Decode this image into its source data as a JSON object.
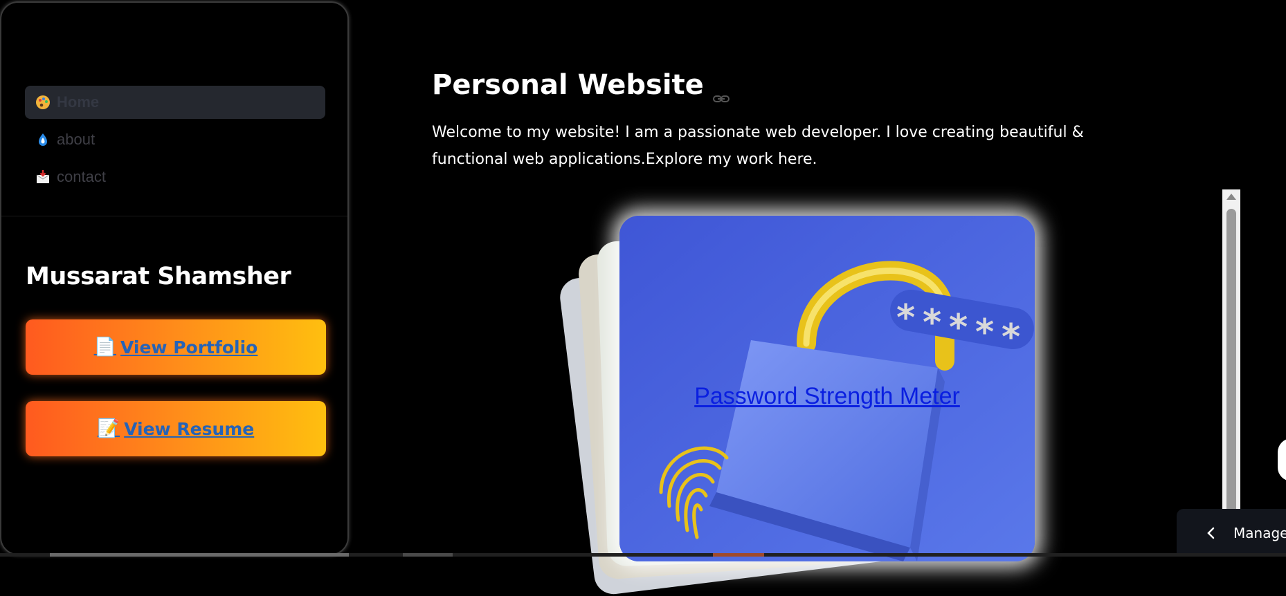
{
  "sidebar": {
    "nav": [
      {
        "label": "Home",
        "icon": "palette-icon"
      },
      {
        "label": "about",
        "icon": "drop-icon"
      },
      {
        "label": "contact",
        "icon": "inbox-tray-icon"
      }
    ],
    "name": "Mussarat Shamsher",
    "buttons": [
      {
        "label": "View Portfolio",
        "icon": "page-facing-up-icon",
        "glyph": "📄"
      },
      {
        "label": "View Resume",
        "icon": "memo-icon",
        "glyph": "📝"
      }
    ]
  },
  "main": {
    "title": "Personal Website",
    "intro": "Welcome to my website! I am a passionate web developer. I love creating beautiful & functional web applications.Explore my work here.",
    "carousel": {
      "active_card_link": "Password Strength Meter"
    }
  },
  "footer": {
    "manage_label": "Manage a"
  },
  "colors": {
    "accent_orange": "#ff5a1f",
    "accent_yellow": "#ffbf0f",
    "link_blue": "#2563b8",
    "card_blue": "#4a63dc"
  }
}
